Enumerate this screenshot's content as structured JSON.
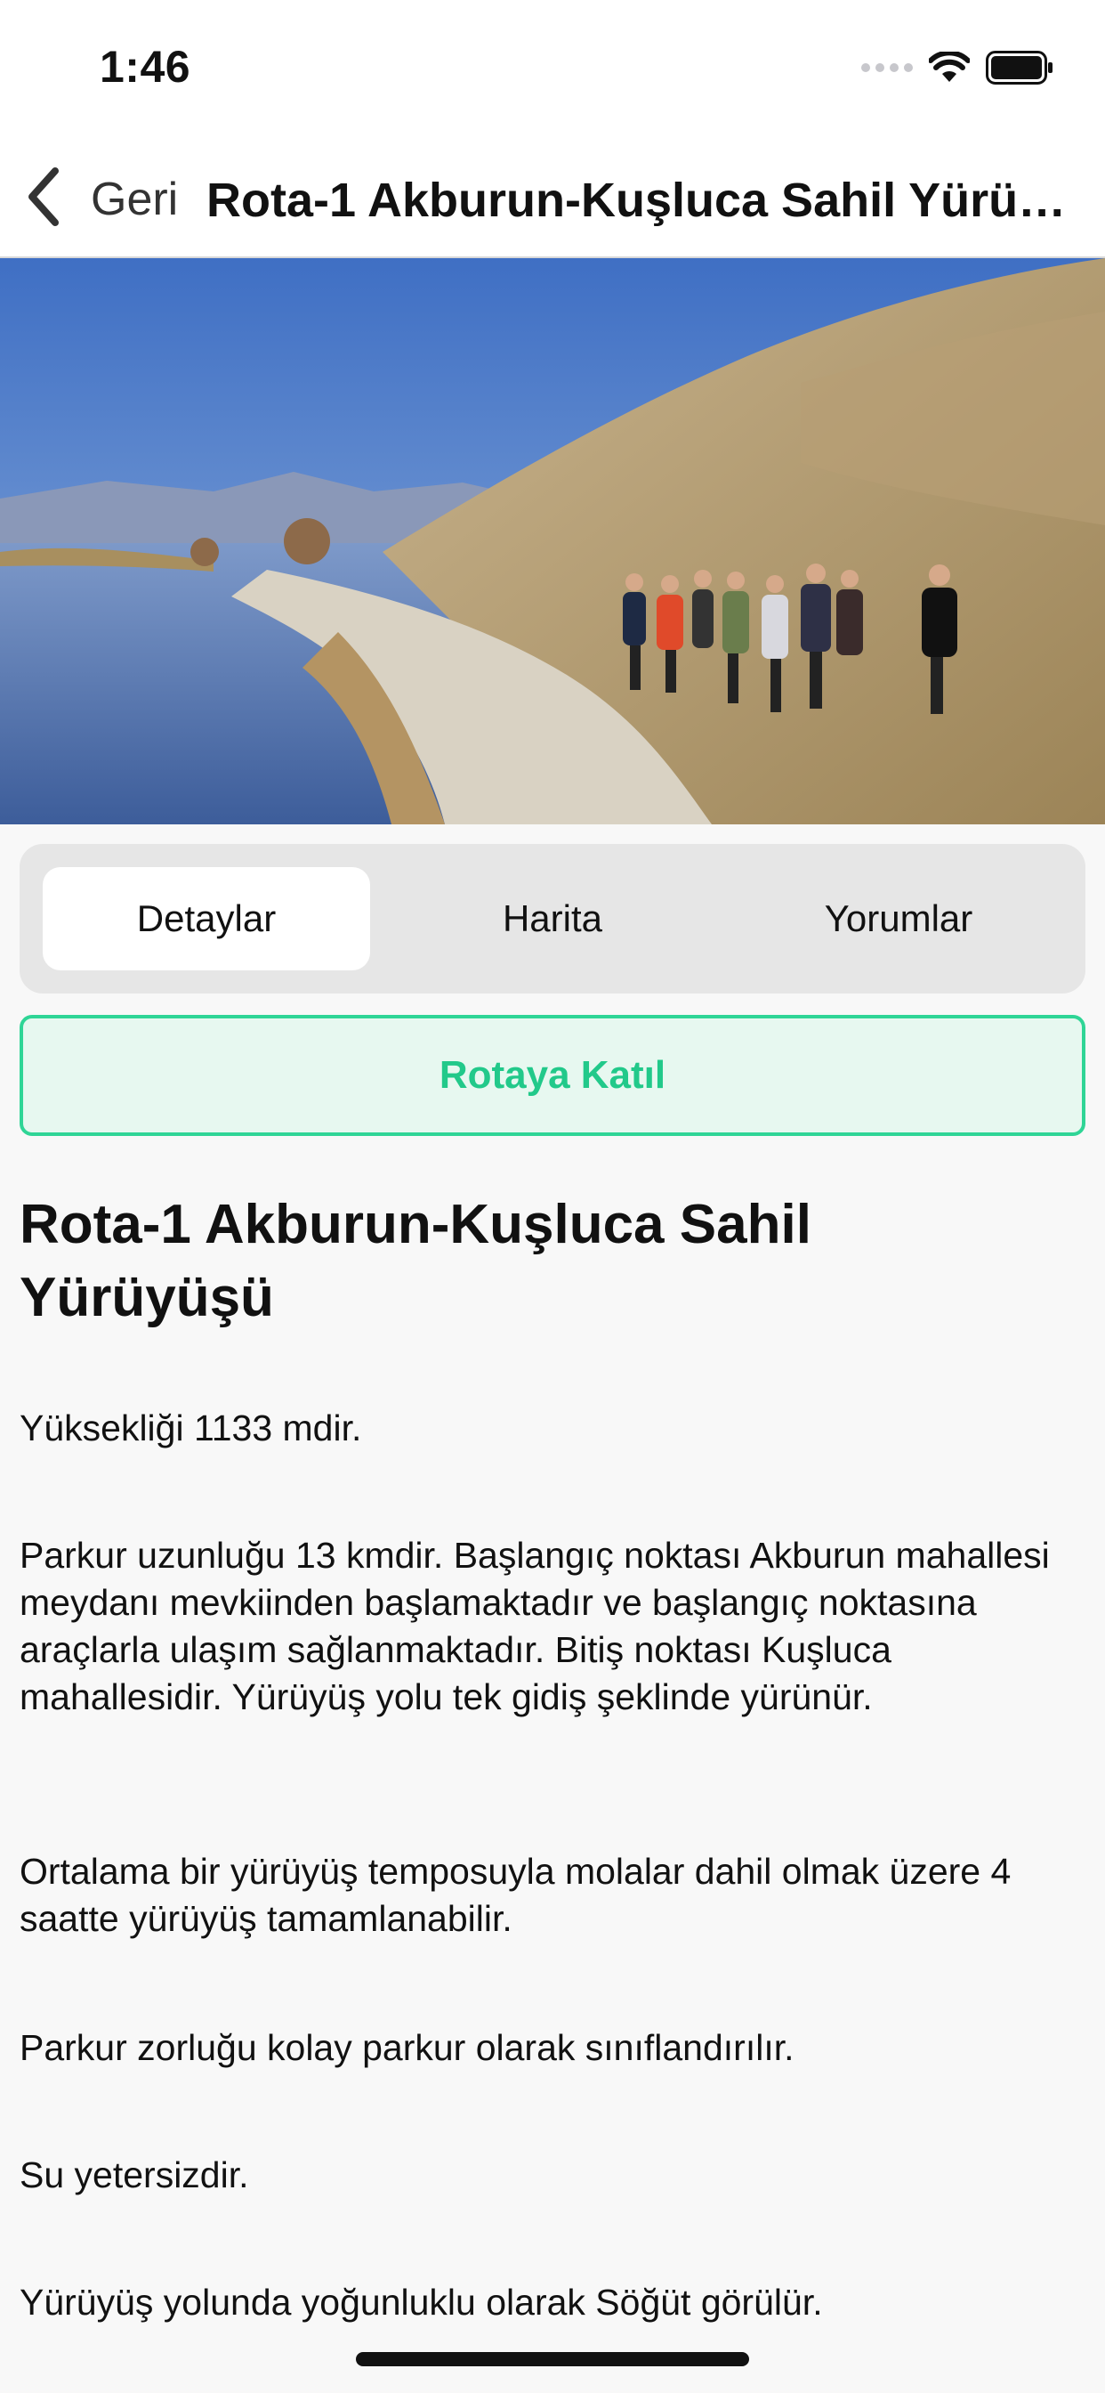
{
  "status_bar": {
    "time": "1:46",
    "icons": [
      "signal-dots-icon",
      "wifi-icon",
      "battery-icon"
    ]
  },
  "nav": {
    "back_label": "Geri",
    "title": "Rota-1 Akburun-Kuşluca Sahil Yürüyüşü"
  },
  "tabs": [
    {
      "label": "Detaylar",
      "active": true
    },
    {
      "label": "Harita",
      "active": false
    },
    {
      "label": "Yorumlar",
      "active": false
    }
  ],
  "join_button": {
    "label": "Rotaya Katıl"
  },
  "content": {
    "title": "Rota-1 Akburun-Kuşluca Sahil Yürüyüşü",
    "paragraphs": [
      "Yüksekliği 1133 mdir.",
      "Parkur uzunluğu 13 kmdir. Başlangıç noktası Akburun mahallesi meydanı mevkiinden başlamaktadır ve başlangıç noktasına araçlarla ulaşım sağlanmaktadır. Bitiş noktası Kuşluca mahallesidir. Yürüyüş yolu tek gidiş şeklinde yürünür.",
      "Ortalama bir yürüyüş temposuyla molalar dahil olmak üzere 4 saatte yürüyüş tamamlanabilir.",
      "Parkur zorluğu kolay parkur olarak sınıflandırılır.",
      "Su yetersizdir.",
      "Yürüyüş yolunda yoğunluklu olarak Söğüt görülür."
    ]
  },
  "colors": {
    "accent": "#22c98a",
    "accent_border": "#2fd596",
    "accent_bg": "#e7f8f0",
    "segment_bg": "#e6e6e6",
    "page_bg": "#f8f8f8"
  }
}
